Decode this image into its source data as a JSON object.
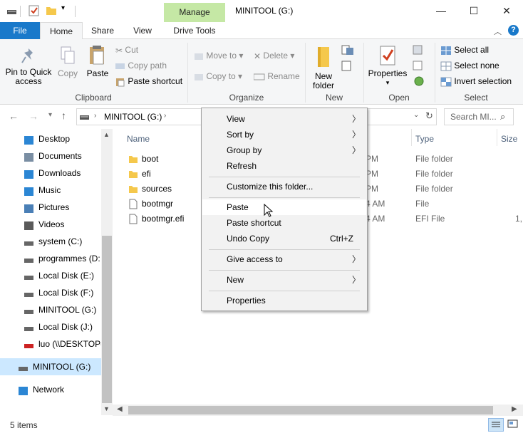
{
  "window": {
    "title": "MINITOOL (G:)",
    "context_tab": "Manage",
    "controls": {
      "minimize": "—",
      "maximize": "☐",
      "close": "✕"
    }
  },
  "tabs": {
    "file": "File",
    "home": "Home",
    "share": "Share",
    "view": "View",
    "drive_tools": "Drive Tools"
  },
  "ribbon": {
    "clipboard": {
      "label": "Clipboard",
      "pin": "Pin to Quick access",
      "copy": "Copy",
      "paste": "Paste",
      "cut": "Cut",
      "copy_path": "Copy path",
      "paste_shortcut": "Paste shortcut"
    },
    "organize": {
      "label": "Organize",
      "move_to": "Move to",
      "copy_to": "Copy to",
      "delete": "Delete",
      "rename": "Rename"
    },
    "new": {
      "label": "New",
      "new_folder": "New folder"
    },
    "open": {
      "label": "Open",
      "properties": "Properties"
    },
    "select": {
      "label": "Select",
      "select_all": "Select all",
      "select_none": "Select none",
      "invert_selection": "Invert selection"
    }
  },
  "address": {
    "path": "MINITOOL (G:)",
    "search_placeholder": "Search MI..."
  },
  "nav": {
    "items": [
      {
        "label": "Desktop",
        "icon": "desktop-icon",
        "color": "#2b86d4"
      },
      {
        "label": "Documents",
        "icon": "documents-icon",
        "color": "#7a8ea3"
      },
      {
        "label": "Downloads",
        "icon": "downloads-icon",
        "color": "#2b86d4"
      },
      {
        "label": "Music",
        "icon": "music-icon",
        "color": "#2b86d4"
      },
      {
        "label": "Pictures",
        "icon": "pictures-icon",
        "color": "#4a7fb6"
      },
      {
        "label": "Videos",
        "icon": "videos-icon",
        "color": "#5a5a5a"
      },
      {
        "label": "system (C:)",
        "icon": "drive-icon",
        "color": "#666666"
      },
      {
        "label": "programmes (D:",
        "icon": "drive-icon",
        "color": "#666666"
      },
      {
        "label": "Local Disk (E:)",
        "icon": "drive-icon",
        "color": "#666666"
      },
      {
        "label": "Local Disk (F:)",
        "icon": "drive-icon",
        "color": "#666666"
      },
      {
        "label": "MINITOOL (G:)",
        "icon": "drive-icon",
        "color": "#666666"
      },
      {
        "label": "Local Disk (J:)",
        "icon": "drive-icon",
        "color": "#666666"
      },
      {
        "label": "luo (\\\\DESKTOP-",
        "icon": "network-drive-icon",
        "color": "#cc2222"
      },
      {
        "label": "MINITOOL (G:)",
        "icon": "drive-icon",
        "color": "#666666",
        "selected": true
      },
      {
        "label": "Network",
        "icon": "network-icon",
        "color": "#2b86d4"
      }
    ]
  },
  "filelist": {
    "columns": {
      "name": "Name",
      "type": "Type",
      "size": "Size"
    },
    "rows": [
      {
        "name": "boot",
        "date": "PM",
        "type": "File folder",
        "size": "",
        "icon": "folder-icon"
      },
      {
        "name": "efi",
        "date": "PM",
        "type": "File folder",
        "size": "",
        "icon": "folder-icon"
      },
      {
        "name": "sources",
        "date": "PM",
        "type": "File folder",
        "size": "",
        "icon": "folder-icon"
      },
      {
        "name": "bootmgr",
        "date": "4 AM",
        "type": "File",
        "size": "",
        "icon": "file-icon"
      },
      {
        "name": "bootmgr.efi",
        "date": "4 AM",
        "type": "EFI File",
        "size": "1,",
        "icon": "file-icon"
      }
    ]
  },
  "status": {
    "items_count": "5 items"
  },
  "context_menu": {
    "view": "View",
    "sort_by": "Sort by",
    "group_by": "Group by",
    "refresh": "Refresh",
    "customize": "Customize this folder...",
    "paste": "Paste",
    "paste_shortcut": "Paste shortcut",
    "undo_copy": "Undo Copy",
    "undo_shortcut": "Ctrl+Z",
    "give_access": "Give access to",
    "new": "New",
    "properties": "Properties"
  },
  "colors": {
    "accent": "#1979ca",
    "manage_tab": "#c5e8a5",
    "folder": "#f5c84c"
  }
}
